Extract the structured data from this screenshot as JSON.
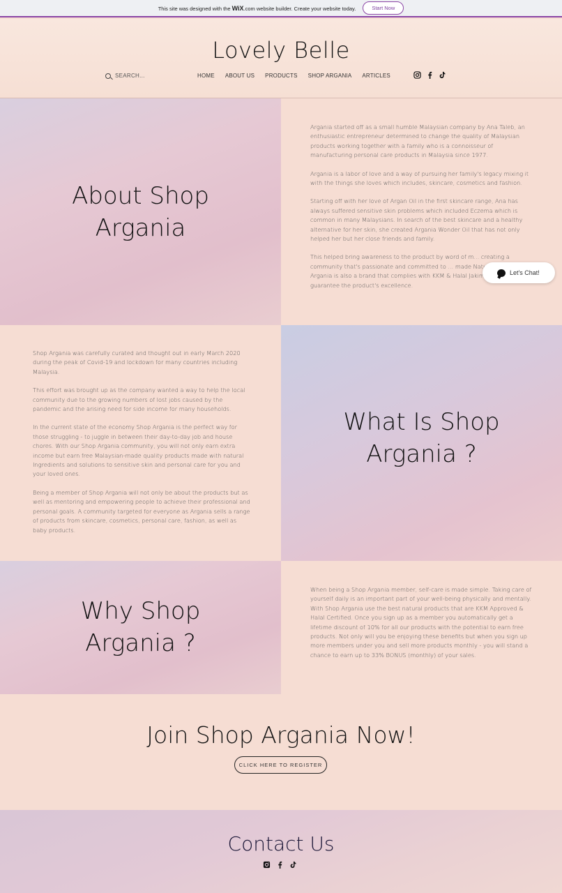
{
  "wix_banner": {
    "message_prefix": "This site was designed with the",
    "brand": "WiX",
    "brand_suffix": ".com",
    "message_suffix": "website builder. Create your website today.",
    "button": "Start Now"
  },
  "header": {
    "logo": "Lovely Belle",
    "search_placeholder": "SEARCH...",
    "nav": [
      "HOME",
      "ABOUT US",
      "PRODUCTS",
      "SHOP ARGANIA",
      "ARTICLES"
    ],
    "social_icons": [
      "instagram-icon",
      "facebook-icon",
      "tiktok-icon"
    ]
  },
  "about": {
    "title_line1": "About Shop",
    "title_line2": "Argania",
    "paragraphs": [
      "Argania started off as a small humble Malaysian company by Ana Taleb, an enthusiastic entrepreneur determined to change the quality of Malaysian products working together with a family who is a connoisseur of manufacturing personal care products in Malaysia since 1977.",
      "Argania is a labor of love and a way of pursuing her family's legacy mixing it with the things she loves which includes, skincare, cosmetics and fashion.",
      "Starting off with her love of Argan Oil in the first skincare range, Ana has always suffered sensitive skin problems which included Eczema which is common in many Malaysians. In search of the best skincare and a healthy alternative for her skin, she created Argania Wonder Oil that has not only helped her but her close friends and family.",
      "This helped bring awareness to the product by word of m... creating a community that's passionate and committed to ... made Natural Products. Argania is also a brand that complies with KKM & Halal Jakim standards to guarantee the product's excellence."
    ]
  },
  "what": {
    "title_line1": "What Is Shop",
    "title_line2": "Argania ?",
    "paragraphs": [
      "Shop Argania was carefully curated and thought out in early March 2020 during the peak of Covid-19 and lockdown for many countries including Malaysia.",
      "This effort was brought up as the company wanted a way to help the local community due to the growing numbers of lost jobs caused by the pandemic and the arising need for side income for many households.",
      "In the current state of the economy Shop Argania is the perfect way for those struggling - to juggle in between their day-to-day job and house chores. With our Shop Argania community, you will not only earn extra income but earn free Malaysian-made quality products made with natural Ingredients and solutions to sensitive skin and personal care for you and your loved ones.",
      "Being a member of Shop Argania will not only be about the products but as well as mentoring and empowering people to achieve their professional and personal goals. A community targeted for everyone as Argania sells a range of products from skincare, cosmetics, personal care, fashion, as well as baby products."
    ]
  },
  "why": {
    "title_line1": "Why Shop",
    "title_line2": "Argania ?",
    "paragraphs": [
      "When being a Shop Argania member, self-care is made simple. Taking care of yourself daily is an important part of your well-being physically and mentally. With Shop Argania use the best natural products that are KKM Approved & Halal Certified. Once you sign up as a member you automatically get a lifetime discount of 10% for all our products with the potential to earn free products. Not only will you be enjoying these benefits but when you sign up more members under you and sell more products monthly - you will stand a chance to earn up to 33% BONUS (monthly) of your sales."
    ]
  },
  "join": {
    "title": "Join Shop Argania Now!",
    "button": "CLICK HERE TO REGISTER"
  },
  "chat": {
    "label": "Let's Chat!"
  },
  "contact": {
    "title": "Contact Us",
    "social_icons": [
      "instagram-icon",
      "facebook-icon",
      "tiktok-icon"
    ]
  }
}
